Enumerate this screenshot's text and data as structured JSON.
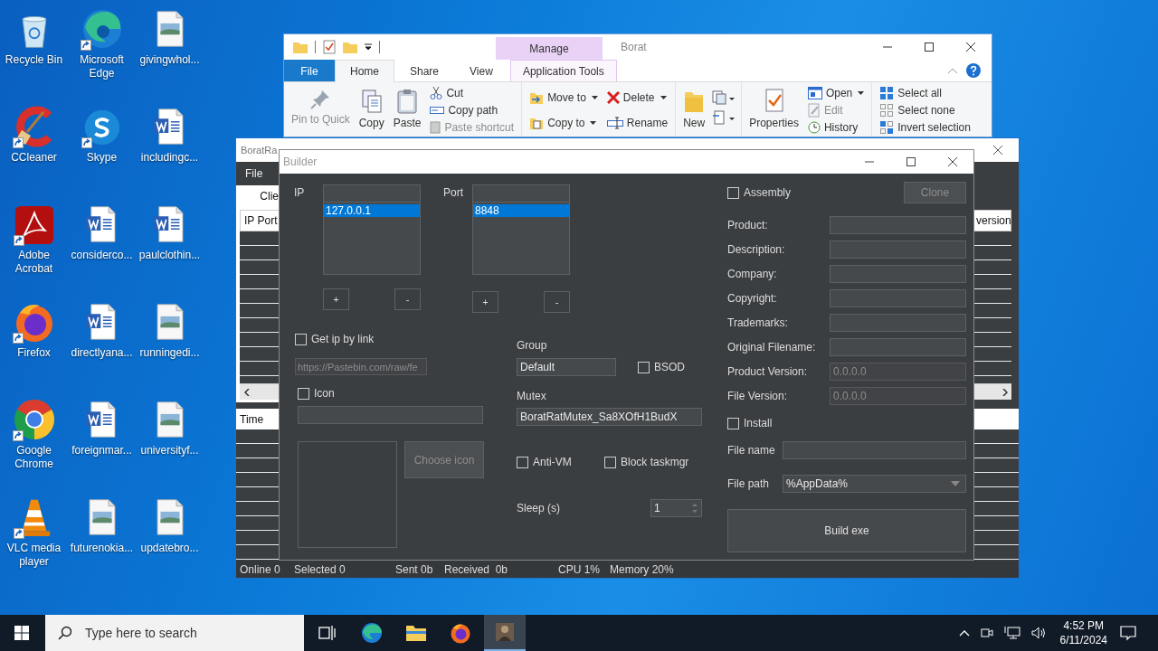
{
  "desktop_icons": [
    {
      "label": "Recycle Bin",
      "kind": "recycle",
      "shortcut": false
    },
    {
      "label": "CCleaner",
      "kind": "ccleaner",
      "shortcut": true
    },
    {
      "label": "Adobe Acrobat",
      "kind": "acrobat",
      "shortcut": true
    },
    {
      "label": "Firefox",
      "kind": "firefox",
      "shortcut": true
    },
    {
      "label": "Google Chrome",
      "kind": "chrome",
      "shortcut": true
    },
    {
      "label": "VLC media player",
      "kind": "vlc",
      "shortcut": true
    },
    {
      "label": "Microsoft Edge",
      "kind": "edge",
      "shortcut": true
    },
    {
      "label": "Skype",
      "kind": "skype",
      "shortcut": true
    },
    {
      "label": "considerco...",
      "kind": "word",
      "shortcut": false
    },
    {
      "label": "directlyana...",
      "kind": "word",
      "shortcut": false
    },
    {
      "label": "foreignmar...",
      "kind": "word",
      "shortcut": false
    },
    {
      "label": "futurenokia...",
      "kind": "image",
      "shortcut": false
    },
    {
      "label": "givingwhol...",
      "kind": "image",
      "shortcut": false
    },
    {
      "label": "includingc...",
      "kind": "word",
      "shortcut": false
    },
    {
      "label": "paulclothin...",
      "kind": "word",
      "shortcut": false
    },
    {
      "label": "runningedi...",
      "kind": "image",
      "shortcut": false
    },
    {
      "label": "universityf...",
      "kind": "image",
      "shortcut": false
    },
    {
      "label": "updatebro...",
      "kind": "image",
      "shortcut": false
    }
  ],
  "explorer": {
    "context_tab": "Manage",
    "title": "Borat",
    "tabs": [
      {
        "label": "File",
        "kind": "file",
        "selected": false
      },
      {
        "label": "Home",
        "kind": "tab",
        "selected": true
      },
      {
        "label": "Share",
        "kind": "tab",
        "selected": false
      },
      {
        "label": "View",
        "kind": "tab",
        "selected": false
      },
      {
        "label": "Application Tools",
        "kind": "context",
        "selected": false
      }
    ],
    "ribbon": {
      "pin_to_quick": {
        "label": "Pin to Quick",
        "disabled": true
      },
      "copy": {
        "label": "Copy",
        "disabled": false
      },
      "paste": {
        "label": "Paste",
        "disabled": false
      },
      "cut": {
        "label": "Cut",
        "disabled": false
      },
      "copy_path": {
        "label": "Copy path",
        "disabled": false
      },
      "paste_shortcut": {
        "label": "Paste shortcut",
        "disabled": true
      },
      "move_to": {
        "label": "Move to",
        "dropdown": true
      },
      "copy_to": {
        "label": "Copy to",
        "dropdown": true
      },
      "delete": {
        "label": "Delete",
        "dropdown": true
      },
      "rename": {
        "label": "Rename",
        "dropdown": false
      },
      "new_folder": {
        "label": "New"
      },
      "properties": {
        "label": "Properties"
      },
      "open": {
        "label": "Open",
        "dropdown": true,
        "disabled": false
      },
      "edit": {
        "label": "Edit",
        "disabled": true
      },
      "history": {
        "label": "History",
        "disabled": false
      },
      "select_all": {
        "label": "Select all"
      },
      "select_none": {
        "label": "Select none"
      },
      "invert_selection": {
        "label": "Invert selection"
      }
    }
  },
  "boratrat": {
    "title": "BoratRa",
    "menu": [
      "File"
    ],
    "tab": "Clie",
    "clients_columns": [
      "IP Port",
      "version"
    ],
    "log_columns": [
      "Time"
    ],
    "status": [
      "Online 0",
      "Selected 0",
      "Sent 0b",
      "Received  0b",
      "CPU 1%",
      "Memory 20%"
    ]
  },
  "builder": {
    "title": "Builder",
    "ip": {
      "label": "IP",
      "entries": [
        {
          "text": "127.0.0.1",
          "selected": true
        }
      ],
      "add": "+",
      "remove": "-"
    },
    "port": {
      "label": "Port",
      "entries": [
        {
          "text": "8848",
          "selected": true
        }
      ],
      "add": "+",
      "remove": "-"
    },
    "get_ip_by_link": {
      "label": "Get ip by link",
      "checked": false
    },
    "link_field": {
      "value": "https://Pastebin.com/raw/fe",
      "disabled": true
    },
    "icon": {
      "label": "Icon",
      "checked": false
    },
    "choose_icon": {
      "label": "Choose icon",
      "disabled": true
    },
    "group": {
      "label": "Group",
      "value": "Default"
    },
    "bsod": {
      "label": "BSOD",
      "checked": false
    },
    "mutex": {
      "label": "Mutex",
      "value": "BoratRatMutex_Sa8XOfH1BudX"
    },
    "anti_vm": {
      "label": "Anti-VM",
      "checked": false
    },
    "block_taskmgr": {
      "label": "Block taskmgr",
      "checked": false
    },
    "sleep": {
      "label": "Sleep (s)",
      "value": "1"
    },
    "assembly": {
      "label": "Assembly",
      "checked": false
    },
    "clone": {
      "label": "Clone",
      "disabled": true
    },
    "assembly_fields": [
      {
        "label": "Product:"
      },
      {
        "label": "Description:"
      },
      {
        "label": "Company:"
      },
      {
        "label": "Copyright:"
      },
      {
        "label": "Trademarks:"
      },
      {
        "label": "Original Filename:"
      },
      {
        "label": "Product Version:",
        "value": "0.0.0.0",
        "disabled": true
      },
      {
        "label": "File Version:",
        "value": "0.0.0.0",
        "disabled": true
      }
    ],
    "install": {
      "label": "Install",
      "checked": false
    },
    "file_name": {
      "label": "File name"
    },
    "file_path": {
      "label": "File path",
      "value": "%AppData%"
    },
    "build": {
      "label": "Build exe"
    }
  },
  "taskbar": {
    "search_placeholder": "Type here to search",
    "apps": [
      {
        "kind": "taskview",
        "selected": false
      },
      {
        "kind": "edge",
        "selected": false
      },
      {
        "kind": "explorer",
        "selected": false
      },
      {
        "kind": "firefox",
        "selected": false
      },
      {
        "kind": "app",
        "selected": true
      }
    ],
    "time": "4:52 PM",
    "date": "6/11/2024"
  }
}
